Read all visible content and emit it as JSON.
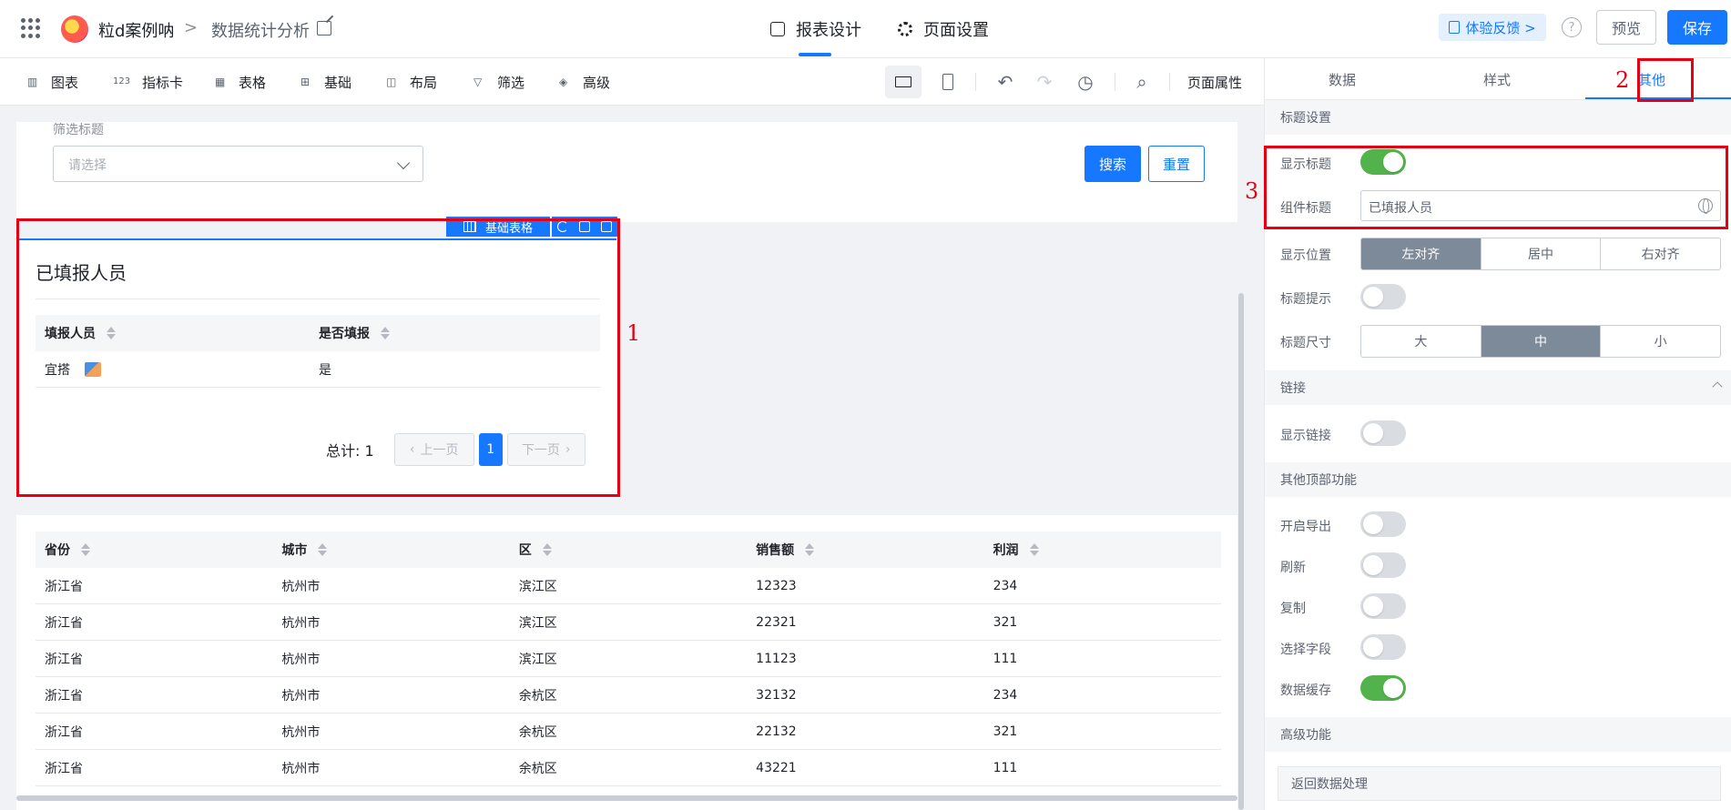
{
  "header": {
    "app_name": "粒d案例呐",
    "breadcrumb_sep": ">",
    "page_name": "数据统计分析",
    "tabs": [
      {
        "label": "报表设计"
      },
      {
        "label": "页面设置"
      }
    ],
    "feedback_label": "体验反馈 >",
    "help_glyph": "?",
    "preview_label": "预览",
    "save_label": "保存",
    "accent": "#1677ff"
  },
  "toolbar": {
    "items": [
      {
        "label": "图表",
        "icon": "bar-chart-icon"
      },
      {
        "label": "指标卡",
        "icon": "number-card-icon"
      },
      {
        "label": "表格",
        "icon": "table-icon"
      },
      {
        "label": "基础",
        "icon": "basic-grid-icon"
      },
      {
        "label": "布局",
        "icon": "layout-icon"
      },
      {
        "label": "筛选",
        "icon": "filter-icon"
      },
      {
        "label": "高级",
        "icon": "layers-icon"
      }
    ],
    "page_prop_label": "页面属性"
  },
  "filter": {
    "label": "筛选标题",
    "placeholder": "请选择",
    "search_label": "搜索",
    "reset_label": "重置"
  },
  "component": {
    "tag_label": "基础表格",
    "title": "已填报人员",
    "columns": [
      "填报人员",
      "是否填报"
    ],
    "rows": [
      [
        "宜搭",
        "是"
      ]
    ],
    "total_label": "总计: 1",
    "prev_label": "上一页",
    "current_page": "1",
    "next_label": "下一页"
  },
  "main_table": {
    "columns": [
      "省份",
      "城市",
      "区",
      "销售额",
      "利润"
    ],
    "rows": [
      [
        "浙江省",
        "杭州市",
        "滨江区",
        "12323",
        "234"
      ],
      [
        "浙江省",
        "杭州市",
        "滨江区",
        "22321",
        "321"
      ],
      [
        "浙江省",
        "杭州市",
        "滨江区",
        "11123",
        "111"
      ],
      [
        "浙江省",
        "杭州市",
        "余杭区",
        "32132",
        "234"
      ],
      [
        "浙江省",
        "杭州市",
        "余杭区",
        "22132",
        "321"
      ],
      [
        "浙江省",
        "杭州市",
        "余杭区",
        "43221",
        "111"
      ]
    ]
  },
  "panel": {
    "tabs": [
      {
        "label": "数据"
      },
      {
        "label": "样式"
      },
      {
        "label": "其他"
      }
    ],
    "active_tab": "其他",
    "title_section": {
      "heading": "标题设置",
      "show_title_label": "显示标题",
      "show_title_on": true,
      "comp_title_label": "组件标题",
      "comp_title_value": "已填报人员",
      "position_label": "显示位置",
      "position_options": [
        "左对齐",
        "居中",
        "右对齐"
      ],
      "position_selected": "左对齐",
      "tip_label": "标题提示",
      "tip_on": false,
      "size_label": "标题尺寸",
      "size_options": [
        "大",
        "中",
        "小"
      ],
      "size_selected": "中"
    },
    "link_section": {
      "heading": "链接",
      "show_link_label": "显示链接",
      "show_link_on": false
    },
    "top_section": {
      "heading": "其他顶部功能",
      "items": [
        {
          "label": "开启导出",
          "on": false
        },
        {
          "label": "刷新",
          "on": false
        },
        {
          "label": "复制",
          "on": false
        },
        {
          "label": "选择字段",
          "on": false
        },
        {
          "label": "数据缓存",
          "on": true
        }
      ]
    },
    "advanced_section": {
      "heading": "高级功能",
      "item": "返回数据处理"
    }
  },
  "annotations": [
    "1",
    "2",
    "3"
  ]
}
